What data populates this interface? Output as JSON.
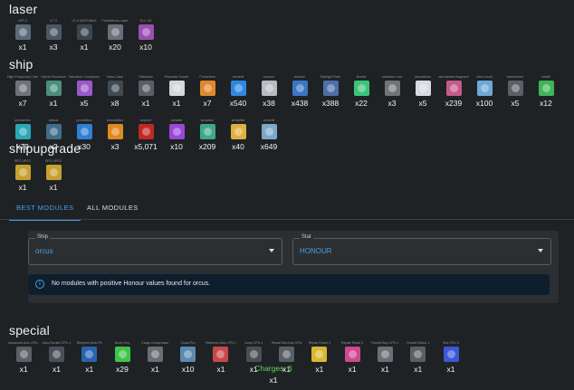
{
  "sections": {
    "laser": {
      "title": "laser",
      "items": [
        {
          "name": "HST-3",
          "qty": "x1",
          "color": "#5a6a78"
        },
        {
          "name": "LF-3",
          "qty": "x3",
          "color": "#4a5866"
        },
        {
          "name": "LF-4 UNSTABLE",
          "qty": "x1",
          "color": "#3c4650"
        },
        {
          "name": "Prometheus Laser",
          "qty": "x20",
          "color": "#6b6f7a"
        },
        {
          "name": "ELL-X3",
          "qty": "x10",
          "color": "#9a4fb3"
        }
      ]
    },
    "ship": {
      "title": "ship",
      "items": [
        {
          "name": "High Frequency Cable",
          "qty": "x7",
          "color": "#6e7378"
        },
        {
          "name": "Hybrid Processor",
          "qty": "x1",
          "color": "#4b8f7a"
        },
        {
          "name": "Nanotech Components",
          "qty": "x5",
          "color": "#9a58c8"
        },
        {
          "name": "Nano Case",
          "qty": "x8",
          "color": "#3f4a52"
        },
        {
          "name": "Palladium",
          "qty": "x1",
          "color": "#5a5f66"
        },
        {
          "name": "Prismatic Socket",
          "qty": "x1",
          "color": "#d4d6da"
        },
        {
          "name": "Prometium",
          "qty": "x7",
          "color": "#e0882d"
        },
        {
          "name": "xenomit",
          "qty": "x540",
          "color": "#2f88e0"
        },
        {
          "name": "seprom",
          "qty": "x38",
          "color": "#b8bcc2"
        },
        {
          "name": "boltrum",
          "qty": "x438",
          "color": "#3a76c4"
        },
        {
          "name": "Starlight Flare",
          "qty": "x388",
          "color": "#4c6faa"
        },
        {
          "name": "fluorite",
          "qty": "x22",
          "color": "#3cc47a"
        },
        {
          "name": "cadmium core",
          "qty": "x3",
          "color": "#707478"
        },
        {
          "name": "darmatrium",
          "qty": "x5",
          "color": "#d8dce0"
        },
        {
          "name": "darmatrium fragment",
          "qty": "x239",
          "color": "#c45a8a"
        },
        {
          "name": "ultra circuit",
          "qty": "x100",
          "color": "#6fa8d8"
        },
        {
          "name": "transformer",
          "qty": "x5",
          "color": "#5a6066"
        },
        {
          "name": "hitrate",
          "qty": "x12",
          "color": "#3fb45a"
        },
        {
          "name": "promerium",
          "qty": "x79",
          "color": "#2aa8b8"
        },
        {
          "name": "plexus",
          "qty": "x2",
          "color": "#3f6e8a"
        },
        {
          "name": "prometium",
          "qty": "x30",
          "color": "#2e7fd6"
        },
        {
          "name": "ammunition",
          "qty": "x3",
          "color": "#e08a1e"
        },
        {
          "name": "seprom",
          "qty": "x5,071",
          "color": "#c02828"
        },
        {
          "name": "xdracite",
          "qty": "x10",
          "color": "#9a48d8"
        },
        {
          "name": "scrapium",
          "qty": "x209",
          "color": "#3fa88a"
        },
        {
          "name": "seraphite",
          "qty": "x40",
          "color": "#e0b040"
        },
        {
          "name": "xenomit",
          "qty": "x649",
          "color": "#7aa8c8"
        }
      ]
    },
    "shipupgrade": {
      "title": "shipupgrade",
      "items": [
        {
          "name": "SPC UPG1",
          "qty": "x1",
          "color": "#c8a030"
        },
        {
          "name": "SPC UPG2",
          "qty": "x1",
          "color": "#c8a030"
        }
      ]
    },
    "special": {
      "title": "special",
      "items": [
        {
          "name": "Advanced Auto CPU 1",
          "qty": "x1",
          "color": "#5a6066"
        },
        {
          "name": "Auto-Rocket CPU 1",
          "qty": "x1",
          "color": "#4a5058"
        },
        {
          "name": "Blueprint Auto-Fit",
          "qty": "x1",
          "color": "#2a64b0"
        },
        {
          "name": "Booty Key",
          "qty": "x29",
          "color": "#3fc44a"
        },
        {
          "name": "Cargo Compressor",
          "qty": "x1",
          "color": "#6a6e74"
        },
        {
          "name": "Cloak-Pro",
          "qty": "x10",
          "color": "#5a8ab0"
        },
        {
          "name": "Hellstorm Auto CPU 1",
          "qty": "x1",
          "color": "#c84848"
        },
        {
          "name": "Jump CPU 1",
          "qty": "x1",
          "color": "#4a4f56"
        },
        {
          "name": "Repair Bot Auto CPU",
          "qty": "x1",
          "color": "#5a5f66"
        },
        {
          "name": "Repair Robot 3",
          "qty": "x1",
          "color": "#d8b830"
        },
        {
          "name": "Repair Robot 4",
          "qty": "x1",
          "color": "#d04890"
        },
        {
          "name": "Rocket Buy CPU 1",
          "qty": "x1",
          "color": "#6a7078"
        },
        {
          "name": "Rocket Robot 1",
          "qty": "x1",
          "color": "#5a5f66"
        },
        {
          "name": "Slot CPU 3",
          "qty": "x1",
          "color": "#3a58d8"
        }
      ],
      "charges_label": "Charges: 6",
      "charges_qty": "x1"
    }
  },
  "tabs": [
    {
      "label": "BEST MODULES",
      "active": true
    },
    {
      "label": "ALL MODULES",
      "active": false
    }
  ],
  "filters": {
    "ship": {
      "label": "Ship",
      "value": "orcus"
    },
    "stat": {
      "label": "Stat",
      "value": "HONOUR"
    }
  },
  "alert": {
    "message": "No modules with positive Honour values found for orcus.",
    "icon": "info-icon"
  },
  "colors": {
    "accent": "#4a9eea",
    "background": "#1f2224",
    "panel": "#2b2f31",
    "alert_bg": "#0f1e2d",
    "charges": "#5fd35f"
  }
}
